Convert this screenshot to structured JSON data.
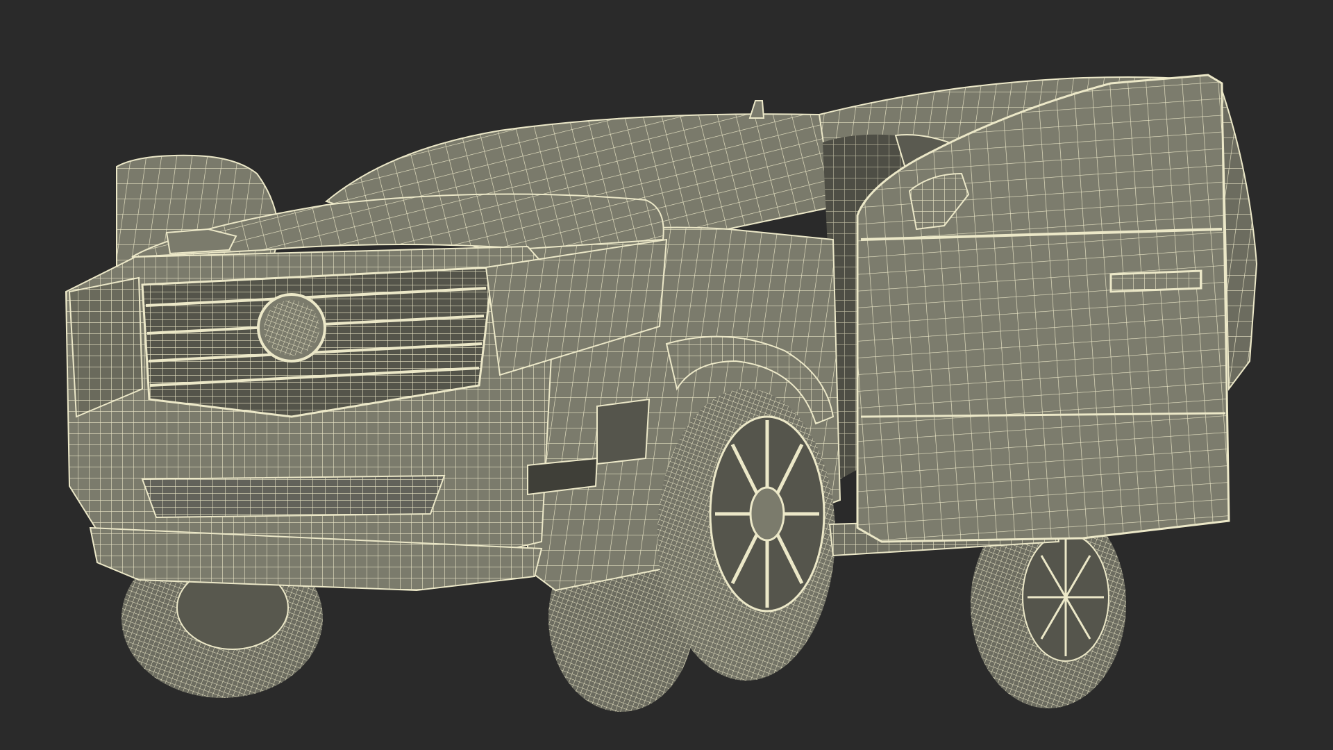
{
  "scene": {
    "subject": "suv-wireframe-model",
    "background_color": "#2a2a2a",
    "body_fill_color": "#7b7b6c",
    "dark_fill_color": "#4a4a42",
    "wire_color": "#ece8c8"
  }
}
